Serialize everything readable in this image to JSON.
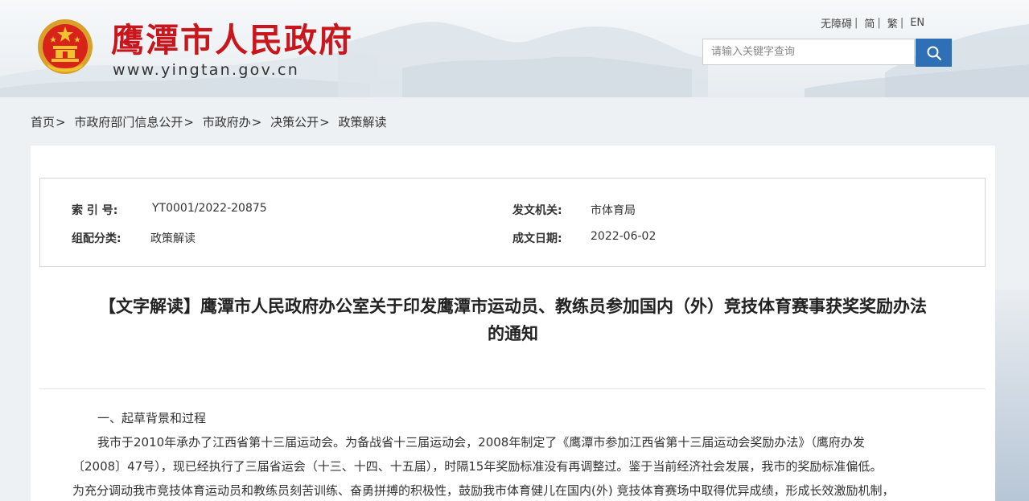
{
  "header": {
    "site_title": "鹰潭市人民政府",
    "site_url": "www.yingtan.gov.cn",
    "brand_color": "#c8161d",
    "top_links": [
      "无障碍",
      "简",
      "繁",
      "EN"
    ],
    "search": {
      "placeholder": "请输入关键字查询"
    }
  },
  "breadcrumb": [
    "首页",
    "市政府部门信息公开",
    "市政府办",
    "决策公开",
    "政策解读"
  ],
  "meta": {
    "index_label": "索 引 号:",
    "index_value": "YT0001/2022-20875",
    "issuer_label": "发文机关:",
    "issuer_value": "市体育局",
    "category_label": "组配分类:",
    "category_value": "政策解读",
    "date_label": "成文日期:",
    "date_value": "2022-06-02"
  },
  "document": {
    "title_line1": "【文字解读】鹰潭市人民政府办公室关于印发鹰潭市运动员、教练员参加国内（外）竞技体育赛事获奖奖励办法",
    "title_line2": "的通知",
    "section1_heading": "一、起草背景和过程",
    "paragraph_lines": [
      "我市于2010年承办了江西省第十三届运动会。为备战省十三届运动会，2008年制定了《鹰潭市参加江西省第十三届运动会奖励办法》（鹰府办发",
      "〔2008〕47号），现已经执行了三届省运会（十三、十四、十五届），时隔15年奖励标准没有再调整过。鉴于当前经济社会发展，我市的奖励标准偏低。",
      "为充分调动我市竞技体育运动员和教练员刻苦训练、奋勇拼搏的积极性，鼓励我市体育健儿在国内(外) 竞技体育赛场中取得优异成绩，形成长效激励机制，"
    ]
  }
}
